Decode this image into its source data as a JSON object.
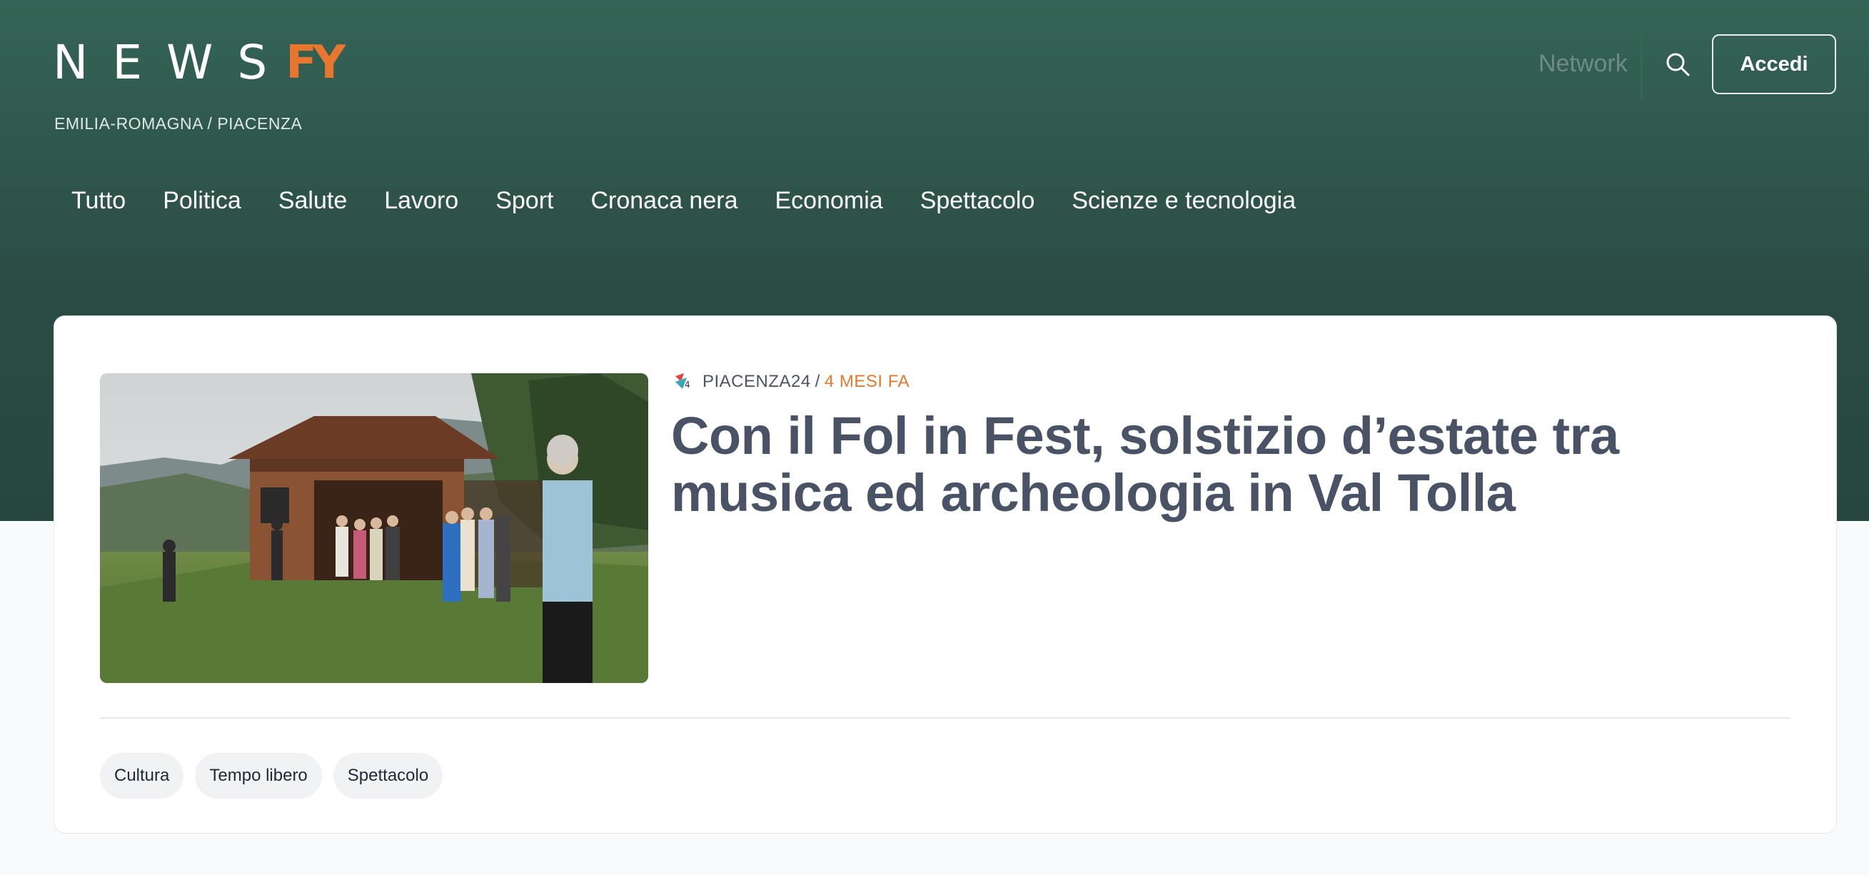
{
  "header": {
    "logo_text": "NEWS",
    "logo_mark": "FY",
    "region": "EMILIA-ROMAGNA / PIACENZA",
    "network_label": "Network",
    "search_icon": "search-icon",
    "login_label": "Accedi"
  },
  "nav": {
    "items": [
      "Tutto",
      "Politica",
      "Salute",
      "Lavoro",
      "Sport",
      "Cronaca nera",
      "Economia",
      "Spettacolo",
      "Scienze e tecnologia"
    ]
  },
  "article": {
    "source": "PIACENZA24",
    "separator": "/",
    "time": "4 MESI FA",
    "title": "Con il Fol in Fest, solstizio d’estate tra musica ed archeologia in Val Tolla",
    "tags": [
      "Cultura",
      "Tempo libero",
      "Spettacolo"
    ]
  },
  "colors": {
    "header_green": "#2f5a4f",
    "accent_orange": "#e07a31",
    "headline": "#4a5366"
  }
}
